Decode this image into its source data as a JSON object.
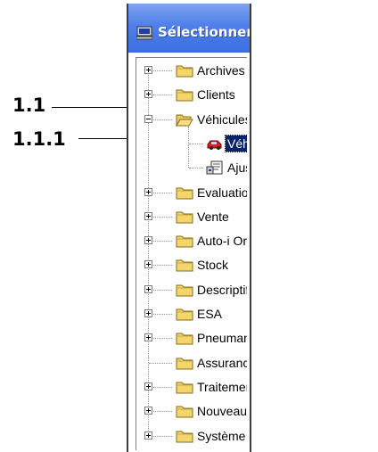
{
  "callouts": [
    {
      "label": "1.1"
    },
    {
      "label": "1.1.1"
    }
  ],
  "window": {
    "title": "Sélectionner",
    "icon": "computer-icon"
  },
  "tree": {
    "items": [
      {
        "label": "Archives",
        "icon": "folder-icon",
        "expander": "plus"
      },
      {
        "label": "Clients",
        "icon": "folder-icon",
        "expander": "plus"
      },
      {
        "label": "Véhicules",
        "icon": "folder-open-icon",
        "expander": "minus"
      },
      {
        "label": "Véhicules",
        "icon": "car-icon",
        "selected": true
      },
      {
        "label": "Ajustement",
        "icon": "settings-document-icon"
      },
      {
        "label": "Evaluation",
        "icon": "folder-icon",
        "expander": "plus"
      },
      {
        "label": "Vente",
        "icon": "folder-icon",
        "expander": "plus"
      },
      {
        "label": "Auto-i Organizer",
        "icon": "folder-icon",
        "expander": "plus"
      },
      {
        "label": "Stock",
        "icon": "folder-icon",
        "expander": "plus"
      },
      {
        "label": "Descriptif",
        "icon": "folder-icon",
        "expander": "plus"
      },
      {
        "label": "ESA",
        "icon": "folder-icon",
        "expander": "plus"
      },
      {
        "label": "Pneumanager",
        "icon": "folder-icon",
        "expander": "plus"
      },
      {
        "label": "Assurances",
        "icon": "folder-icon"
      },
      {
        "label": "Traitement de texte",
        "icon": "folder-icon",
        "expander": "plus"
      },
      {
        "label": "Nouveautés",
        "icon": "folder-icon",
        "expander": "plus"
      },
      {
        "label": "Système",
        "icon": "folder-icon",
        "expander": "plus"
      }
    ]
  },
  "colors": {
    "titlebar": "#3a6fe2",
    "selection": "#0a246a",
    "folder": "#f2d66b"
  }
}
